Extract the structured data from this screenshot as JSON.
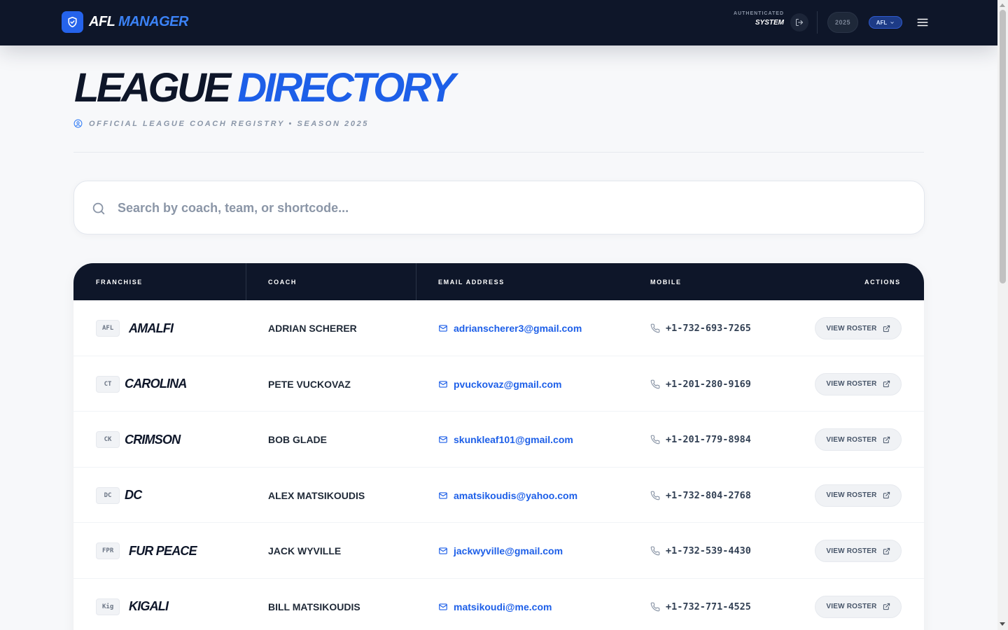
{
  "app": {
    "brand_primary": "AFL",
    "brand_accent": "MANAGER",
    "brand_color": "#2563eb"
  },
  "topbar": {
    "auth_label": "AUTHENTICATED",
    "auth_user": "SYSTEM",
    "season_pill": "2025",
    "league_pill": "AFL",
    "logout_icon": "logout-icon",
    "menu_icon": "hamburger-menu-icon"
  },
  "header": {
    "title_primary": "LEAGUE",
    "title_accent": "DIRECTORY",
    "subtitle": "OFFICIAL LEAGUE COACH REGISTRY • SEASON 2025",
    "accent_color": "#1d5fe8"
  },
  "search": {
    "placeholder": "Search by coach, team, or shortcode...",
    "value": ""
  },
  "table": {
    "columns": {
      "franchise": "FRANCHISE",
      "coach": "COACH",
      "email": "EMAIL ADDRESS",
      "mobile": "MOBILE",
      "actions": "ACTIONS"
    },
    "action_label": "VIEW ROSTER",
    "rows": [
      {
        "code": "AFL",
        "team": "AMALFI",
        "coach": "ADRIAN SCHERER",
        "email": "adrianscherer3@gmail.com",
        "mobile": "+1-732-693-7265"
      },
      {
        "code": "CT",
        "team": "CAROLINA",
        "coach": "PETE VUCKOVAZ",
        "email": "pvuckovaz@gmail.com",
        "mobile": "+1-201-280-9169"
      },
      {
        "code": "CK",
        "team": "CRIMSON",
        "coach": "BOB GLADE",
        "email": "skunkleaf101@gmail.com",
        "mobile": "+1-201-779-8984"
      },
      {
        "code": "DC",
        "team": "DC",
        "coach": "ALEX MATSIKOUDIS",
        "email": "amatsikoudis@yahoo.com",
        "mobile": "+1-732-804-2768"
      },
      {
        "code": "FPR",
        "team": "FUR PEACE",
        "coach": "JACK WYVILLE",
        "email": "jackwyville@gmail.com",
        "mobile": "+1-732-539-4430"
      },
      {
        "code": "Kig",
        "team": "KIGALI",
        "coach": "BILL MATSIKOUDIS",
        "email": "matsikoudi@me.com",
        "mobile": "+1-732-771-4525"
      }
    ]
  }
}
